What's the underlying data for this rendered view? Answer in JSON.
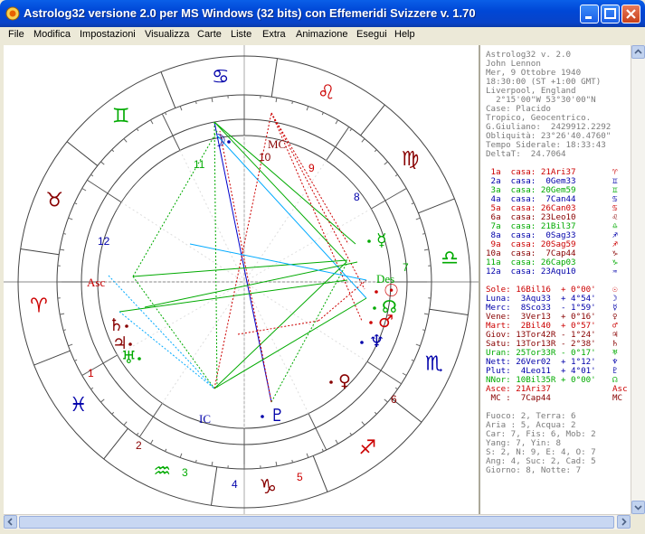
{
  "window": {
    "title": "Astrolog32 versione 2.0 per MS Windows (32 bits) con Effemeridi Svizzere v. 1.70"
  },
  "menu": [
    "File",
    "Modifica",
    "Impostazioni",
    "Visualizza",
    "Carte",
    "Liste",
    "Extra",
    "Animazione",
    "Esegui",
    "Help"
  ],
  "info": {
    "header": [
      "Astrolog32 v. 2.0",
      "John Lennon",
      "Mer, 9 Ottobre 1940",
      "18:30:00 (ST +1:00 GMT)",
      "Liverpool, England",
      "  2°15'00\"W 53°30'00\"N",
      "Case: Placido",
      "Tropico, Geocentrico.",
      "G.Giuliano:  2429912.2292",
      "Obliquità: 23°26'40.4760\"",
      "Tempo Siderale: 18:33:43",
      "DeltaT:  24.7064"
    ],
    "houses": [
      {
        "text": " 1a  casa: 21Ari37",
        "glyph": "♈",
        "color": "#cc0000"
      },
      {
        "text": " 2a  casa:  0Gem33",
        "glyph": "♊",
        "color": "#0000aa"
      },
      {
        "text": " 3a  casa: 20Gem59",
        "glyph": "♊",
        "color": "#00aa00"
      },
      {
        "text": " 4a  casa:  7Can44",
        "glyph": "♋",
        "color": "#0000aa"
      },
      {
        "text": " 5a  casa: 26Can03",
        "glyph": "♋",
        "color": "#cc0000"
      },
      {
        "text": " 6a  casa: 23Leo10",
        "glyph": "♌",
        "color": "#880000"
      },
      {
        "text": " 7a  casa: 21Bil37",
        "glyph": "♎",
        "color": "#00aa00"
      },
      {
        "text": " 8a  casa:  0Sag33",
        "glyph": "♐",
        "color": "#0000aa"
      },
      {
        "text": " 9a  casa: 20Sag59",
        "glyph": "♐",
        "color": "#cc0000"
      },
      {
        "text": "10a  casa:  7Cap44",
        "glyph": "♑",
        "color": "#880000"
      },
      {
        "text": "11a  casa: 26Cap03",
        "glyph": "♑",
        "color": "#00aa00"
      },
      {
        "text": "12a  casa: 23Aqu10",
        "glyph": "♒",
        "color": "#0000aa"
      }
    ],
    "planets": [
      {
        "text": "Sole: 16Bil16  + 0°00'",
        "glyph": "☉",
        "color": "#cc0000"
      },
      {
        "text": "Luna:  3Aqu33  + 4°54'",
        "glyph": "☽",
        "color": "#0000aa"
      },
      {
        "text": "Merc:  8Sco33  - 1°59'",
        "glyph": "☿",
        "color": "#0000aa"
      },
      {
        "text": "Vene:  3Ver13  + 0°16'",
        "glyph": "♀",
        "color": "#880000"
      },
      {
        "text": "Mart:  2Bil40  + 0°57'",
        "glyph": "♂",
        "color": "#cc0000"
      },
      {
        "text": "Giov: 13Tor42R - 1°24'",
        "glyph": "♃",
        "color": "#880000"
      },
      {
        "text": "Satu: 13Tor13R - 2°38'",
        "glyph": "♄",
        "color": "#880000"
      },
      {
        "text": "Uran: 25Tor33R - 0°17'",
        "glyph": "♅",
        "color": "#00aa00"
      },
      {
        "text": "Nett: 26Ver02  + 1°12'",
        "glyph": "♆",
        "color": "#0000aa"
      },
      {
        "text": "Plut:  4Leo11  + 4°01'",
        "glyph": "♇",
        "color": "#0000aa"
      },
      {
        "text": "NNor: 10Bil35R + 0°00'",
        "glyph": "☊",
        "color": "#00aa00"
      },
      {
        "text": "Asce: 21Ari37",
        "glyph": "Asc",
        "color": "#cc0000"
      },
      {
        "text": " MC :  7Cap44",
        "glyph": "MC",
        "color": "#880000"
      }
    ],
    "footer": [
      "Fuoco: 2, Terra: 6",
      "Aria : 5, Acqua: 2",
      "Car: 7, Fis: 6, Mob: 2",
      "Yang: 7, Yin: 8",
      "S: 2, N: 9, E: 4, O: 7",
      "Ang: 4, Suc: 2, Cad: 5",
      "Giorno: 8, Notte: 7"
    ]
  },
  "chart": {
    "zodiac_glyphs": [
      "♈",
      "♉",
      "♊",
      "♋",
      "♌",
      "♍",
      "♎",
      "♏",
      "♐",
      "♑",
      "♒",
      "♓"
    ],
    "house_numbers": [
      "1",
      "2",
      "3",
      "4",
      "5",
      "6",
      "7",
      "8",
      "9",
      "10",
      "11",
      "12"
    ],
    "planet_glyphs": {
      "sun": "☉",
      "moon": "☽",
      "mercury": "☿",
      "venus": "♀",
      "mars": "♂",
      "jupiter": "♃",
      "saturn": "♄",
      "uranus": "♅",
      "neptune": "♆",
      "pluto": "♇",
      "node": "☊"
    },
    "angle_labels": {
      "asc": "Asc",
      "mc": "MC",
      "des": "Des",
      "ic": "IC"
    },
    "colors": {
      "fire": "#cc0000",
      "earth": "#880000",
      "air": "#00aa00",
      "water": "#0000aa"
    }
  }
}
